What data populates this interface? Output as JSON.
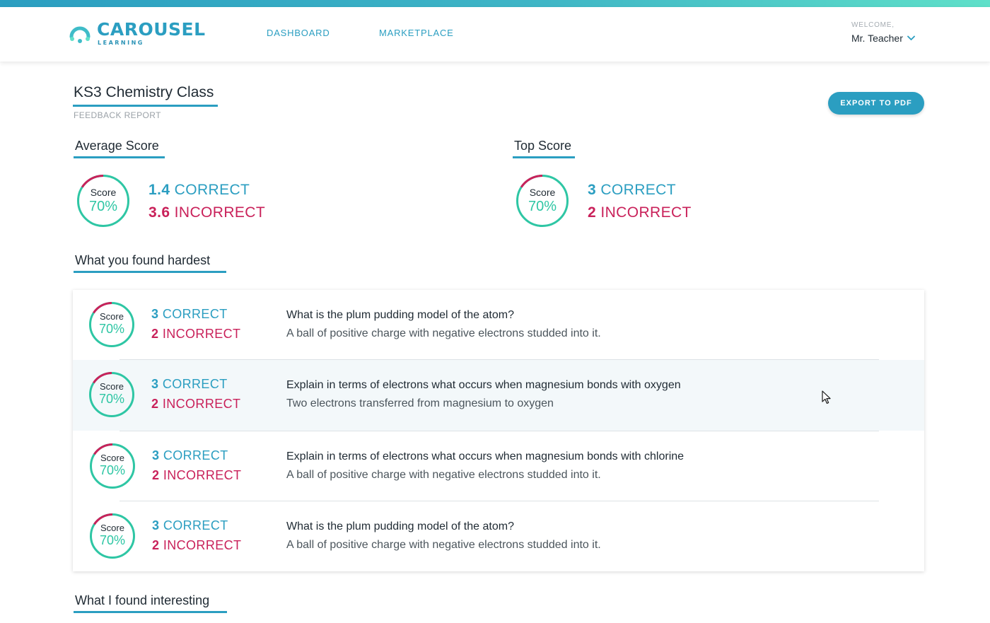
{
  "brand": {
    "name": "CAROUSEL",
    "tagline": "LEARNING",
    "colors": {
      "primary": "#2b9ec1",
      "accent": "#2ec6a4",
      "error": "#c9215a"
    }
  },
  "nav": {
    "links": [
      "DASHBOARD",
      "MARKETPLACE"
    ],
    "welcome_label": "WELCOME,",
    "user_name": "Mr. Teacher"
  },
  "page": {
    "title": "KS3 Chemistry Class",
    "subtitle": "FEEDBACK REPORT",
    "export_label": "EXPORT TO PDF"
  },
  "summary": {
    "average": {
      "heading": "Average Score",
      "score_label": "Score",
      "score_value": "70%",
      "correct_count": "1.4",
      "correct_label": "CORRECT",
      "incorrect_count": "3.6",
      "incorrect_label": "INCORRECT"
    },
    "top": {
      "heading": "Top Score",
      "score_label": "Score",
      "score_value": "70%",
      "correct_count": "3",
      "correct_label": "CORRECT",
      "incorrect_count": "2",
      "incorrect_label": "INCORRECT"
    }
  },
  "hardest": {
    "heading": "What you found hardest",
    "rows": [
      {
        "score_label": "Score",
        "score_value": "70%",
        "correct_count": "3",
        "correct_label": "CORRECT",
        "incorrect_count": "2",
        "incorrect_label": "INCORRECT",
        "question": "What is the plum pudding model of the atom?",
        "answer": "A ball of positive charge with negative electrons studded into it."
      },
      {
        "score_label": "Score",
        "score_value": "70%",
        "correct_count": "3",
        "correct_label": "CORRECT",
        "incorrect_count": "2",
        "incorrect_label": "INCORRECT",
        "question": "Explain in terms of electrons what occurs when magnesium bonds with oxygen",
        "answer": "Two electrons transferred from magnesium to oxygen"
      },
      {
        "score_label": "Score",
        "score_value": "70%",
        "correct_count": "3",
        "correct_label": "CORRECT",
        "incorrect_count": "2",
        "incorrect_label": "INCORRECT",
        "question": "Explain in terms of electrons what occurs when magnesium bonds with chlorine",
        "answer": "A ball of positive charge with negative electrons studded into it."
      },
      {
        "score_label": "Score",
        "score_value": "70%",
        "correct_count": "3",
        "correct_label": "CORRECT",
        "incorrect_count": "2",
        "incorrect_label": "INCORRECT",
        "question": "What is the plum pudding model of the atom?",
        "answer": "A ball of positive charge with negative electrons studded into it."
      }
    ]
  },
  "interesting": {
    "heading": "What I found interesting"
  },
  "icons": [
    "carousel-logo-icon",
    "chevron-down-icon",
    "score-ring-icon",
    "mouse-cursor-icon"
  ]
}
